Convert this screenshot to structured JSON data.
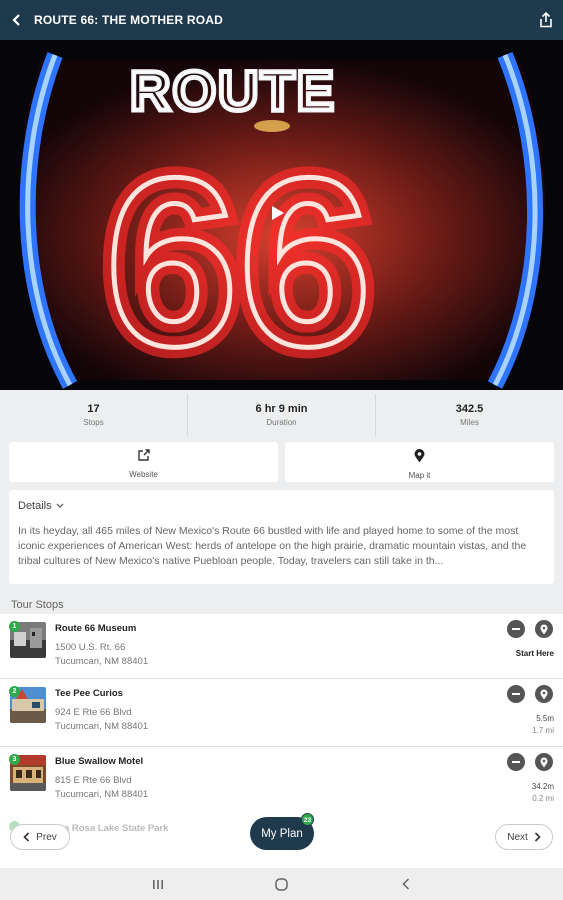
{
  "header": {
    "title": "ROUTE 66: THE MOTHER ROAD",
    "back_icon": "arrow-left-icon",
    "share_icon": "share-icon"
  },
  "hero": {
    "image_alt": "neon route 66 sign",
    "play_icon": "play-icon"
  },
  "stats": [
    {
      "value": "17",
      "label": "Stops"
    },
    {
      "value": "6 hr 9 min",
      "label": "Duration"
    },
    {
      "value": "342.5",
      "label": "Miles"
    }
  ],
  "actions": [
    {
      "label": "Website",
      "icon": "external-link-icon"
    },
    {
      "label": "Map it",
      "icon": "map-pin-icon"
    }
  ],
  "details": {
    "label": "Details",
    "text": "In its heyday, all 465 miles of New Mexico's Route 66 bustled with life and played home to some of the most iconic experiences of American West: herds of antelope on the high prairie, dramatic mountain vistas, and the tribal cultures of New Mexico's native Puebloan people. Today, travelers can still take in th..."
  },
  "tour_stops": {
    "title": "Tour Stops",
    "items": [
      {
        "num": "1",
        "name": "Route 66 Museum",
        "addr1": "1500 U.S. Rt. 66",
        "addr2": "Tucumcari, NM 88401",
        "meta1": "Start Here",
        "meta2": ""
      },
      {
        "num": "2",
        "name": "Tee Pee Curios",
        "addr1": "924 E Rte 66 Blvd",
        "addr2": "Tucumcari, NM 88401",
        "meta1": "5.5m",
        "meta2": "1.7 mi"
      },
      {
        "num": "3",
        "name": "Blue Swallow Motel",
        "addr1": "815 E Rte 66 Blvd",
        "addr2": "Tucumcari, NM 88401",
        "meta1": "34.2m",
        "meta2": "0.2 mi"
      }
    ],
    "partial_name": "nta Rosa Lake State Park"
  },
  "footer": {
    "prev_label": "Prev",
    "next_label": "Next",
    "myplan_label": "My Plan",
    "myplan_badge": "23"
  }
}
